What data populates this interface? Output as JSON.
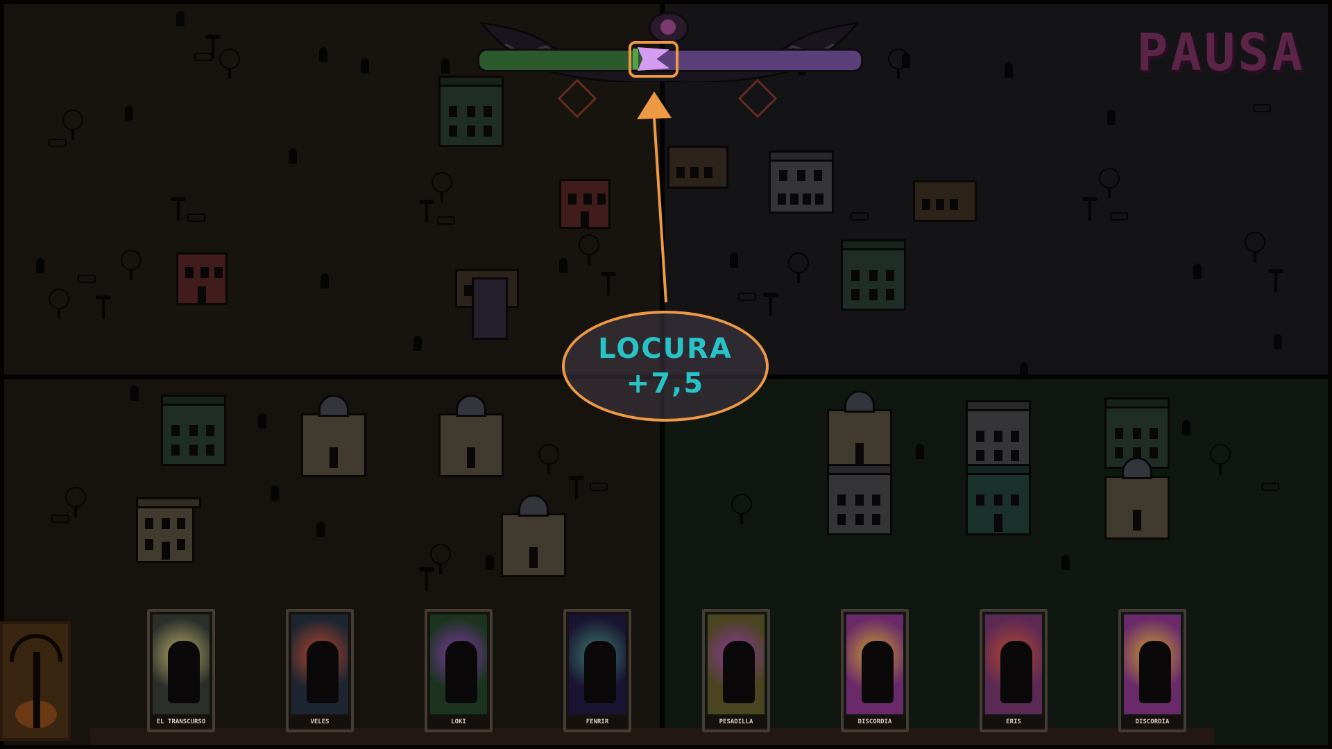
{
  "hud": {
    "pause_label": "PAUSA",
    "meter": {
      "sanity_color": "#2c5a2c",
      "madness_color": "#5a3f7a",
      "pointer_color": "#d69cf2",
      "pointer_position": 0.46
    }
  },
  "annotation": {
    "label": "LOCURA",
    "value": "+7,5",
    "text_color": "#27c3c7",
    "outline_color": "#ee9a45"
  },
  "cards": [
    {
      "name": "EL TRANSCURSO",
      "art_color": "#2a2f2a",
      "glow": "#b5a86a"
    },
    {
      "name": "VELES",
      "art_color": "#1d2630",
      "glow": "#b3442e"
    },
    {
      "name": "LOKI",
      "art_color": "#1c3320",
      "glow": "#7b3aa0"
    },
    {
      "name": "FENRIR",
      "art_color": "#1a1433",
      "glow": "#3a7a6a"
    },
    {
      "name": "PESADILLA",
      "art_color": "#4a4420",
      "glow": "#8a3a9a"
    },
    {
      "name": "DISCORDIA",
      "art_color": "#6a2a6a",
      "glow": "#c89a30"
    },
    {
      "name": "ERIS",
      "art_color": "#5a2a55",
      "glow": "#b3442e"
    },
    {
      "name": "DISCORDIA",
      "art_color": "#6a2a6a",
      "glow": "#c89a30"
    }
  ],
  "deck": {
    "icon": "deck-card-back-icon"
  }
}
